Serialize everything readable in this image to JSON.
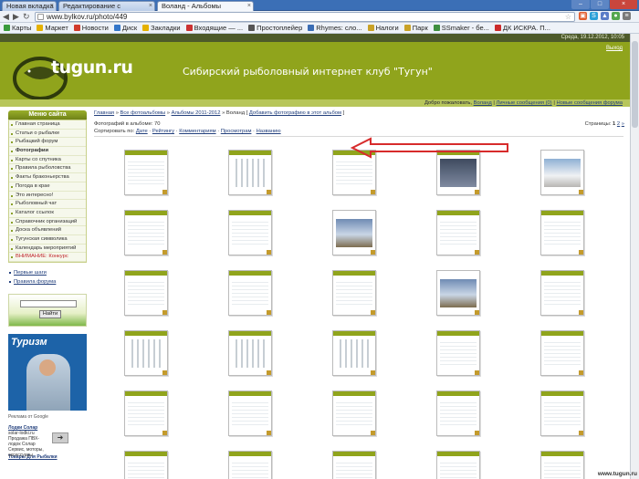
{
  "browser": {
    "tabs": [
      {
        "label": "Новая вкладка"
      },
      {
        "label": "Редактирование с"
      },
      {
        "label": "Воланд - Альбомы"
      }
    ],
    "url": "www.bylkov.ru/photo/449",
    "nav": {
      "back": "◀",
      "forward": "▶",
      "reload": "↻"
    },
    "bookmarks": [
      {
        "label": "Карты",
        "color": "#3a9b3c"
      },
      {
        "label": "Маркет",
        "color": "#e5b100"
      },
      {
        "label": "Новости",
        "color": "#d13b2c"
      },
      {
        "label": "Диск",
        "color": "#3376c9"
      },
      {
        "label": "Закладки",
        "color": "#e5b100"
      },
      {
        "label": "Входящие — ...",
        "color": "#cc3232"
      },
      {
        "label": "Простоплейер",
        "color": "#555555"
      },
      {
        "label": "Rhymes: сло...",
        "color": "#3a6db5"
      },
      {
        "label": "Налоги",
        "color": "#c9a227"
      },
      {
        "label": "Парк",
        "color": "#c9a227"
      },
      {
        "label": "SSmaker - бе...",
        "color": "#3f8f3f"
      },
      {
        "label": "ДК ИСКРА. П...",
        "color": "#cc2b2b"
      }
    ]
  },
  "site": {
    "date_text": "Среда, 19.12.2012, 10:05",
    "logo": "tugun.ru",
    "title": "Сибирский рыболовный интернет клуб \"Тугун\"",
    "exit_link": "Выход",
    "userbar": {
      "welcome": "Добро пожаловать,",
      "user": "Воланд",
      "messages": "Личные сообщения (0)",
      "new_posts": "Новые сообщения форума"
    }
  },
  "sidebar": {
    "menu_title": "Меню сайта",
    "items": [
      {
        "label": "Главная страница",
        "style": ""
      },
      {
        "label": "Статьи о рыбалке",
        "style": ""
      },
      {
        "label": "Рыбацкий форум",
        "style": ""
      },
      {
        "label": "Фотографии",
        "style": "bold"
      },
      {
        "label": "Карты со спутника",
        "style": ""
      },
      {
        "label": "Правила рыболовства",
        "style": ""
      },
      {
        "label": "Факты браконьерства",
        "style": ""
      },
      {
        "label": "Погода в крае",
        "style": ""
      },
      {
        "label": "Это интересно!",
        "style": ""
      },
      {
        "label": "Рыболовный чат",
        "style": ""
      },
      {
        "label": "Каталог ссылок",
        "style": ""
      },
      {
        "label": "Справочник организаций",
        "style": ""
      },
      {
        "label": "Доска объявлений",
        "style": ""
      },
      {
        "label": "Тугунская символика",
        "style": ""
      },
      {
        "label": "Календарь мероприятий",
        "style": ""
      },
      {
        "label": "ВНИМАНИЕ: Конкурс",
        "style": "red"
      }
    ],
    "links": [
      "Первые шаги",
      "Правила форума"
    ],
    "search_button": "Найти",
    "banner_title": "Туризм",
    "ads_by": "Реклама от Google",
    "ad": {
      "title": "Лодки Солар",
      "domain": "solar-lodki.ru",
      "text": "Продажа ПВХ-лодок Солар Сервис, моторы, аксессуары"
    },
    "ad2_title": "Товары Для Рыбалки"
  },
  "main": {
    "breadcrumbs": {
      "home": "Главная",
      "all_albums": "Все фотоальбомы",
      "albums_year": "Альбомы 2011-2012",
      "current": "Воланд",
      "add_photo": "Добавить фотографию в этот альбом"
    },
    "album_info": "Фотографий в альбоме: 70",
    "sort": {
      "label": "Сортировать по:",
      "options": [
        "Дате",
        "Рейтингу",
        "Комментариям",
        "Просмотрам",
        "Названию"
      ]
    },
    "pages": {
      "label": "Страницы:",
      "current": "1",
      "others": [
        "2",
        "»"
      ]
    }
  },
  "thumbnails": [
    "page",
    "grid2",
    "page",
    "dark",
    "photo2",
    "page",
    "page",
    "photo",
    "page",
    "page",
    "page",
    "page",
    "page",
    "photo",
    "page",
    "grid2",
    "grid2",
    "grid2",
    "page",
    "page",
    "page",
    "page",
    "page",
    "page",
    "page",
    "page",
    "page",
    "page",
    "page",
    "page"
  ],
  "annotation": {
    "arrow_color": "#d72b2b"
  },
  "footer_brand": "www.tugun.ru"
}
